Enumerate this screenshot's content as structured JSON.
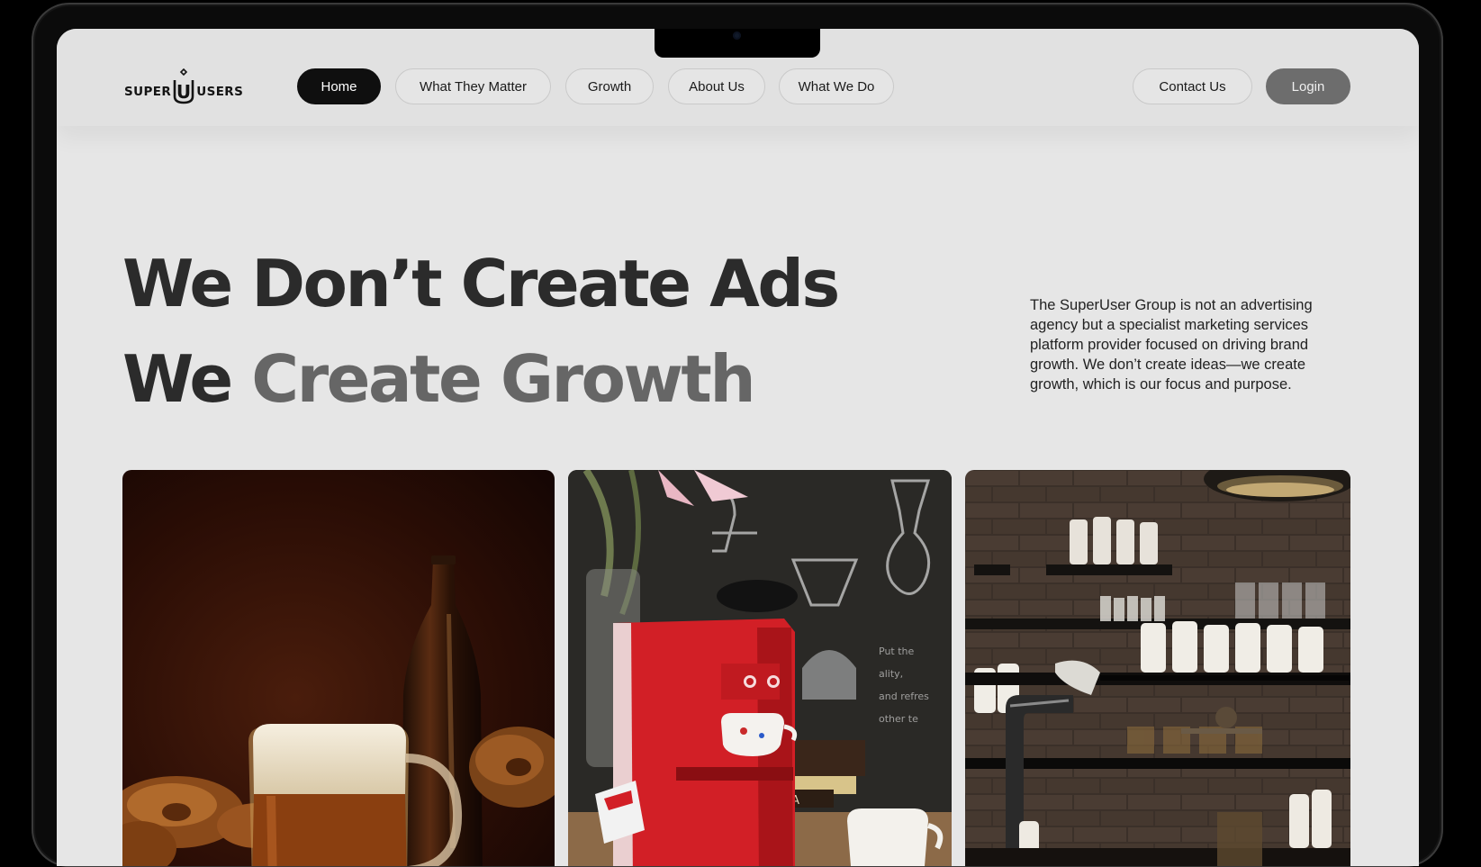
{
  "brand": {
    "logo_left": "SUPER",
    "logo_mid": "U",
    "logo_right": "USERS"
  },
  "nav": {
    "items": [
      {
        "label": "Home",
        "active": true
      },
      {
        "label": "What They Matter",
        "active": false
      },
      {
        "label": "Growth",
        "active": false
      },
      {
        "label": "About Us",
        "active": false
      },
      {
        "label": "What We Do",
        "active": false
      }
    ],
    "contact_label": "Contact Us",
    "login_label": "Login"
  },
  "hero": {
    "line1": "We Don’t Create Ads",
    "line2_lead": "We",
    "line2_accent": "Create Growth",
    "description": "The SuperUser Group is not an advertising agency but a specialist marketing services platform provider focused on driving brand growth. We don’t create ideas—we create growth, which is our focus and purpose."
  },
  "gallery": {
    "coffee_sign_text": "TEA",
    "images": [
      {
        "subject": "beer-and-pretzels-photo"
      },
      {
        "subject": "red-coffee-machine-photo"
      },
      {
        "subject": "bar-shelves-photo"
      }
    ]
  },
  "colors": {
    "page_bg": "#e6e6e6",
    "nav_active": "#0f0f0f",
    "login_bg": "#6d6d6d",
    "heading": "#2b2b2b",
    "heading_accent": "#666666"
  }
}
